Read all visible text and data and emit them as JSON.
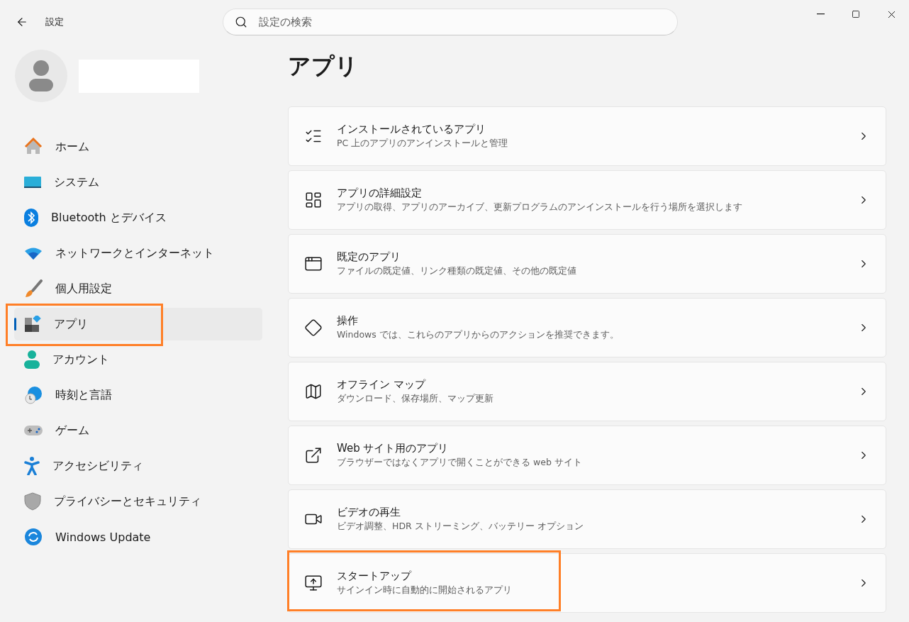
{
  "window": {
    "title": "設定"
  },
  "search": {
    "placeholder": "設定の検索"
  },
  "sidebar": {
    "items": [
      {
        "label": "ホーム",
        "selected": false,
        "highlighted": false
      },
      {
        "label": "システム",
        "selected": false,
        "highlighted": false
      },
      {
        "label": "Bluetooth とデバイス",
        "selected": false,
        "highlighted": false
      },
      {
        "label": "ネットワークとインターネット",
        "selected": false,
        "highlighted": false
      },
      {
        "label": "個人用設定",
        "selected": false,
        "highlighted": false
      },
      {
        "label": "アプリ",
        "selected": true,
        "highlighted": true
      },
      {
        "label": "アカウント",
        "selected": false,
        "highlighted": false
      },
      {
        "label": "時刻と言語",
        "selected": false,
        "highlighted": false
      },
      {
        "label": "ゲーム",
        "selected": false,
        "highlighted": false
      },
      {
        "label": "アクセシビリティ",
        "selected": false,
        "highlighted": false
      },
      {
        "label": "プライバシーとセキュリティ",
        "selected": false,
        "highlighted": false
      },
      {
        "label": "Windows Update",
        "selected": false,
        "highlighted": false
      }
    ]
  },
  "page": {
    "heading": "アプリ",
    "cards": [
      {
        "title": "インストールされているアプリ",
        "description": "PC 上のアプリのアンインストールと管理",
        "highlighted": false
      },
      {
        "title": "アプリの詳細設定",
        "description": "アプリの取得、アプリのアーカイブ、更新プログラムのアンインストールを行う場所を選択します",
        "highlighted": false
      },
      {
        "title": "既定のアプリ",
        "description": "ファイルの既定値、リンク種類の既定値、その他の既定値",
        "highlighted": false
      },
      {
        "title": "操作",
        "description": "Windows では、これらのアプリからのアクションを推奨できます。",
        "highlighted": false
      },
      {
        "title": "オフライン マップ",
        "description": "ダウンロード、保存場所、マップ更新",
        "highlighted": false
      },
      {
        "title": "Web サイト用のアプリ",
        "description": "ブラウザーではなくアプリで開くことができる web サイト",
        "highlighted": false
      },
      {
        "title": "ビデオの再生",
        "description": "ビデオ調整、HDR ストリーミング、バッテリー オプション",
        "highlighted": false
      },
      {
        "title": "スタートアップ",
        "description": "サインイン時に自動的に開始されるアプリ",
        "highlighted": true
      }
    ]
  }
}
